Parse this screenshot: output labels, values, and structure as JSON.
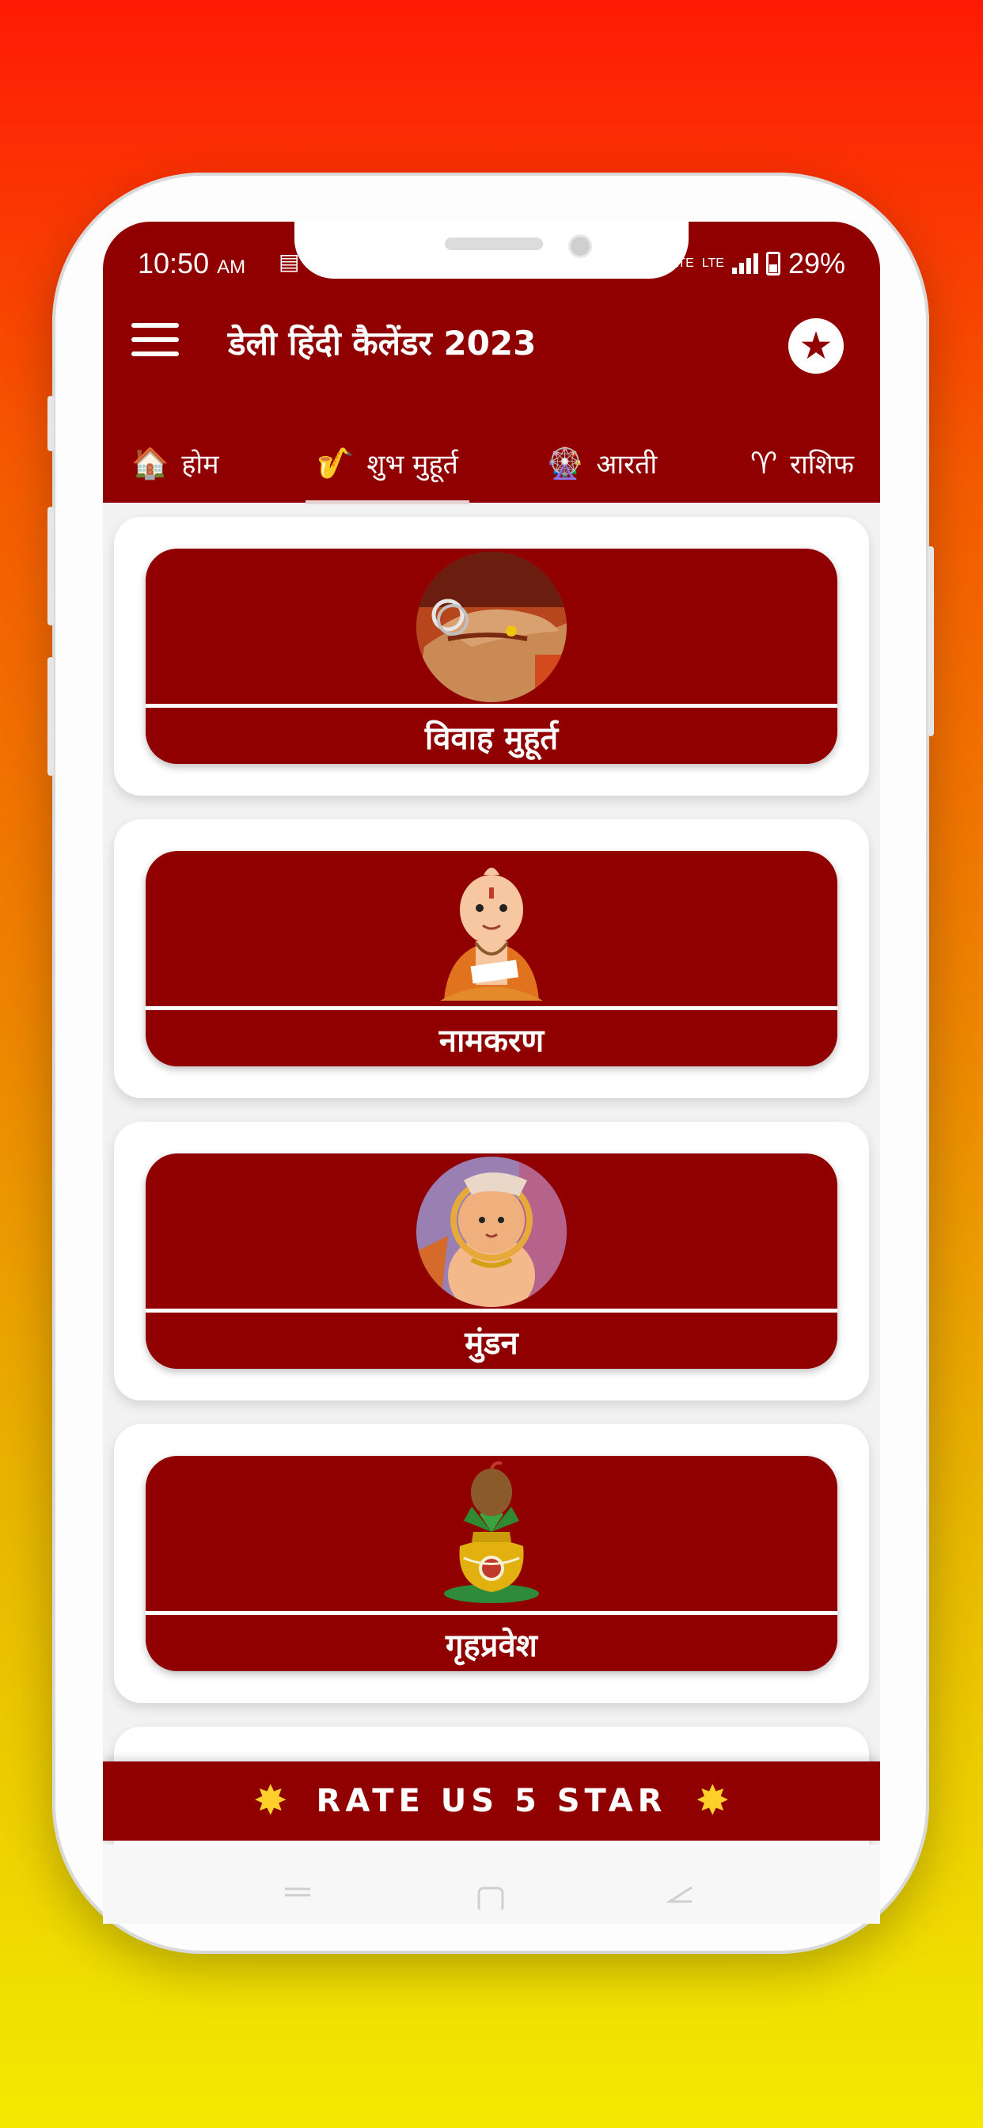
{
  "status_bar": {
    "time": "10:50",
    "ampm": "AM",
    "net_label": "LTE",
    "volte_label": "Vo LTE",
    "battery": "29%"
  },
  "app_bar": {
    "title": "डेली हिंदी कैलेंडर 2023"
  },
  "tabs": [
    {
      "label": "होम",
      "icon": "house-icon",
      "glyph": "🏠"
    },
    {
      "label": "शुभ मुहूर्त",
      "icon": "saxophone-icon",
      "glyph": "🎷"
    },
    {
      "label": "आरती",
      "icon": "ferris-wheel-icon",
      "glyph": "🎡"
    },
    {
      "label": "राशिफ",
      "icon": "aries-icon",
      "glyph": "♈"
    }
  ],
  "active_tab": "शुभ मुहूर्त",
  "cards": [
    {
      "label": "विवाह मुहूर्त",
      "image": "wedding-hands-photo"
    },
    {
      "label": "नामकरण",
      "image": "child-priest-illustration"
    },
    {
      "label": "मुंडन",
      "image": "child-tonsure-illustration"
    },
    {
      "label": "गृहप्रवेश",
      "image": "kalash-illustration"
    }
  ],
  "rate_bar": {
    "label": "RATE US 5 STAR",
    "icon": "glowing-star-icon"
  },
  "colors": {
    "primary": "#900000",
    "background_top": "#ff1a05",
    "background_bottom": "#f3ea00"
  }
}
